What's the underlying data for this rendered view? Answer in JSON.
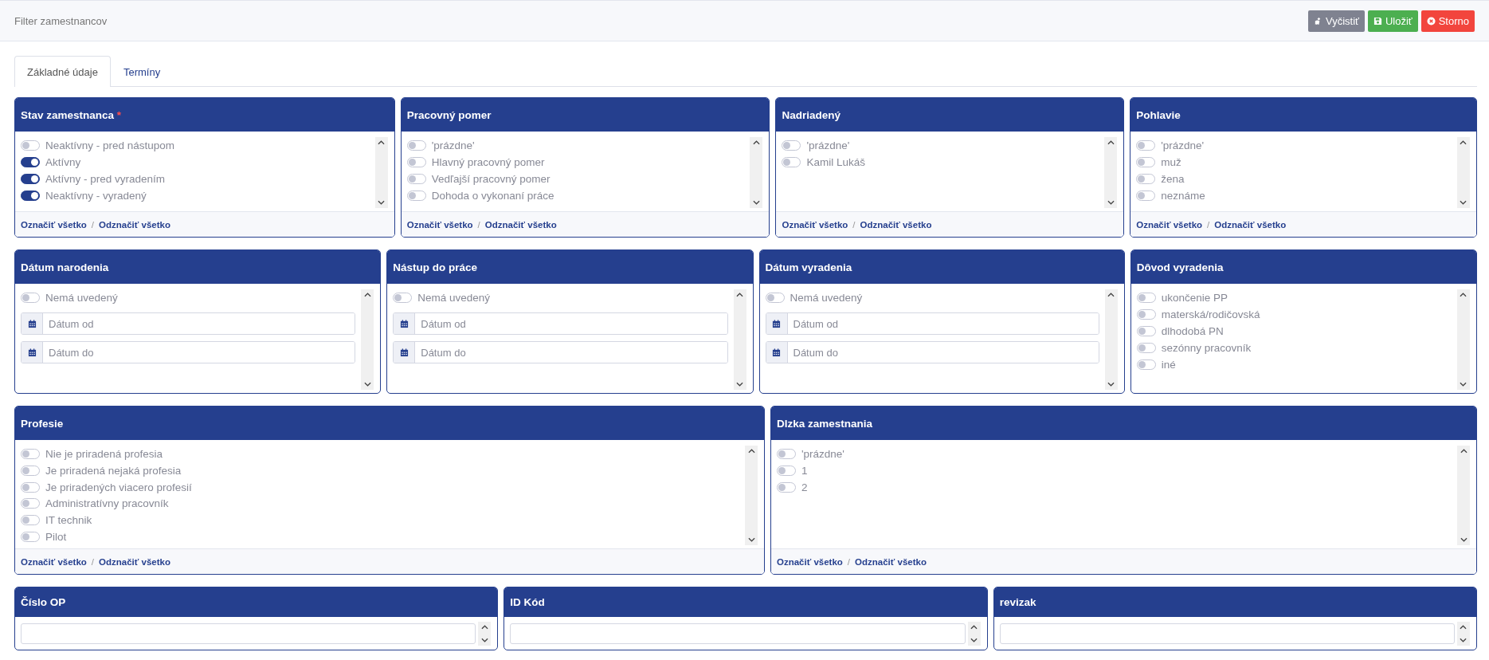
{
  "header": {
    "title": "Filter zamestnancov",
    "buttons": [
      {
        "label": "Vyčistiť",
        "kind": "clear"
      },
      {
        "label": "Uložiť",
        "kind": "save"
      },
      {
        "label": "Storno",
        "kind": "cancel"
      }
    ]
  },
  "tabs": [
    {
      "label": "Základné údaje",
      "selected": true
    },
    {
      "label": "Termíny",
      "selected": false
    }
  ],
  "rows": [
    [
      {
        "title": "Stav zamestnanca",
        "required_mark": "*",
        "kind": "toggles",
        "items": [
          {
            "label": "Neaktívny - pred nástupom",
            "on": false
          },
          {
            "label": "Aktívny",
            "on": true
          },
          {
            "label": "Aktívny - pred vyradením",
            "on": true
          },
          {
            "label": "Neaktívny - vyradený",
            "on": true
          }
        ],
        "footer": {
          "select_all": "Označiť všetko",
          "separator": "/",
          "deselect_all": "Odznačiť všetko"
        }
      },
      {
        "title": "Pracovný pomer",
        "kind": "toggles",
        "items": [
          {
            "label": "'prázdne'",
            "on": false
          },
          {
            "label": "Hlavný pracovný pomer",
            "on": false
          },
          {
            "label": "Vedľajší pracovný pomer",
            "on": false
          },
          {
            "label": "Dohoda o vykonaní práce",
            "on": false
          }
        ],
        "footer": {
          "select_all": "Označiť všetko",
          "separator": "/",
          "deselect_all": "Odznačiť všetko"
        }
      },
      {
        "title": "Nadriadený",
        "kind": "toggles",
        "items": [
          {
            "label": "'prázdne'",
            "on": false
          },
          {
            "label": "Kamil Lukáš",
            "on": false
          }
        ],
        "footer": {
          "select_all": "Označiť všetko",
          "separator": "/",
          "deselect_all": "Odznačiť všetko"
        }
      },
      {
        "title": "Pohlavie",
        "kind": "toggles",
        "items": [
          {
            "label": "'prázdne'",
            "on": false
          },
          {
            "label": "muž",
            "on": false
          },
          {
            "label": "žena",
            "on": false
          },
          {
            "label": "neznáme",
            "on": false
          }
        ],
        "footer": {
          "select_all": "Označiť všetko",
          "separator": "/",
          "deselect_all": "Odznačiť všetko"
        }
      }
    ],
    [
      {
        "title": "Dátum narodenia",
        "kind": "dates",
        "items": [
          {
            "label": "Nemá uvedený",
            "on": false
          }
        ],
        "fields": [
          {
            "placeholder": "Dátum od"
          },
          {
            "placeholder": "Dátum do"
          }
        ]
      },
      {
        "title": "Nástup do práce",
        "kind": "dates",
        "items": [
          {
            "label": "Nemá uvedený",
            "on": false
          }
        ],
        "fields": [
          {
            "placeholder": "Dátum od"
          },
          {
            "placeholder": "Dátum do"
          }
        ]
      },
      {
        "title": "Dátum vyradenia",
        "kind": "dates",
        "items": [
          {
            "label": "Nemá uvedený",
            "on": false
          }
        ],
        "fields": [
          {
            "placeholder": "Dátum od"
          },
          {
            "placeholder": "Dátum do"
          }
        ]
      },
      {
        "title": "Dôvod vyradenia",
        "kind": "toggles",
        "items": [
          {
            "label": "ukončenie PP",
            "on": false
          },
          {
            "label": "materská/rodičovská",
            "on": false
          },
          {
            "label": "dlhodobá PN",
            "on": false
          },
          {
            "label": "sezónny pracovník",
            "on": false
          },
          {
            "label": "iné",
            "on": false
          }
        ]
      }
    ],
    [
      {
        "title": "Profesie",
        "kind": "toggles",
        "items": [
          {
            "label": "Nie je priradená profesia",
            "on": false
          },
          {
            "label": "Je priradená nejaká profesia",
            "on": false
          },
          {
            "label": "Je priradených viacero profesií",
            "on": false
          },
          {
            "label": "Administratívny pracovník",
            "on": false
          },
          {
            "label": "IT technik",
            "on": false
          },
          {
            "label": "Pilot",
            "on": false
          }
        ],
        "footer": {
          "select_all": "Označiť všetko",
          "separator": "/",
          "deselect_all": "Odznačiť všetko"
        }
      },
      {
        "title": "Dlzka zamestnania",
        "kind": "toggles",
        "items": [
          {
            "label": "'prázdne'",
            "on": false
          },
          {
            "label": "1",
            "on": false
          },
          {
            "label": "2",
            "on": false
          }
        ],
        "footer": {
          "select_all": "Označiť všetko",
          "separator": "/",
          "deselect_all": "Odznačiť všetko"
        }
      }
    ],
    [
      {
        "title": "Číslo OP",
        "kind": "number"
      },
      {
        "title": "ID Kód",
        "kind": "number"
      },
      {
        "title": "revizak",
        "kind": "number"
      }
    ]
  ]
}
